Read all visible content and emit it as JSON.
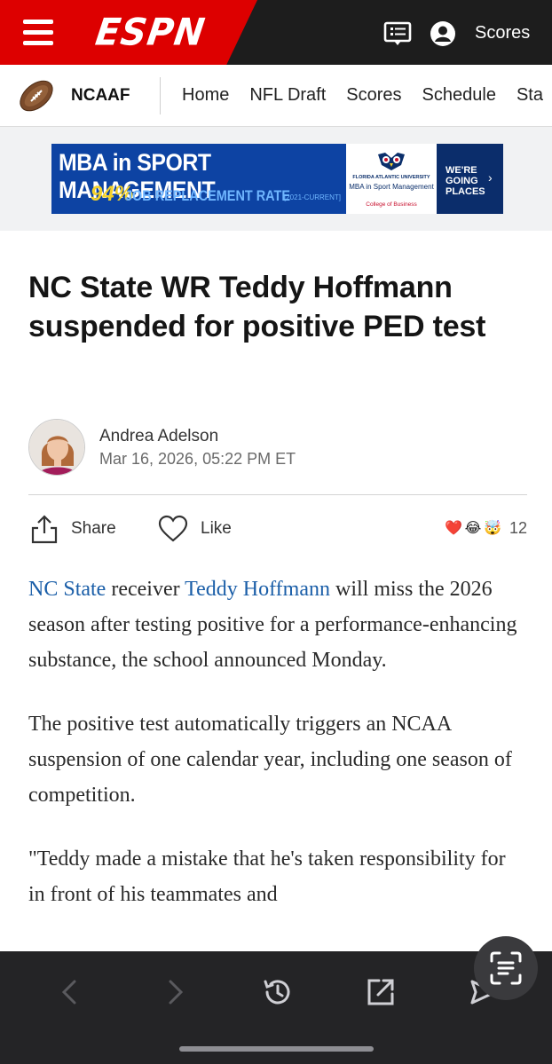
{
  "header": {
    "logo_text": "ESPN",
    "scores_label": "Scores"
  },
  "subnav": {
    "sport": "NCAAF",
    "items": [
      {
        "label": "Home"
      },
      {
        "label": "NFL Draft"
      },
      {
        "label": "Scores"
      },
      {
        "label": "Schedule"
      },
      {
        "label": "Sta"
      }
    ]
  },
  "ad": {
    "title": "MBA in SPORT MANAGEMENT",
    "percent": "94%",
    "rate_text": "JOB REPLACEMENT RATE",
    "years": "[2021-CURRENT]",
    "university": "FLORIDA ATLANTIC UNIVERSITY",
    "program": "MBA in Sport Management",
    "college": "College of Business",
    "cta": "WE'RE GOING PLACES",
    "cta_arrow": "›"
  },
  "article": {
    "headline": "NC State WR Teddy Hoffmann suspended for positive PED test",
    "author": "Andrea Adelson",
    "date": "Mar 16, 2026, 05:22 PM ET",
    "share_label": "Share",
    "like_label": "Like",
    "reactions": [
      "❤️",
      "😂",
      "🤯"
    ],
    "reaction_count": "12",
    "paragraphs": {
      "p1_link1": "NC State",
      "p1_mid": " receiver ",
      "p1_link2": "Teddy Hoffmann",
      "p1_rest": " will miss the 2026 season after testing positive for a performance-enhancing substance, the school announced Monday.",
      "p2": "The positive test automatically triggers an NCAA suspension of one calendar year, including one season of competition.",
      "p3": "\"Teddy made a mistake that he's taken responsibility for in front of his teammates and"
    }
  },
  "colors": {
    "espn_red": "#dd0000",
    "topbar": "#1d1d1d",
    "link": "#1a5ea8",
    "browser_bar": "#242426"
  },
  "browser": {
    "icons": [
      "back-arrow-icon",
      "forward-arrow-icon",
      "history-icon",
      "share-out-icon",
      "send-icon",
      "text-scan-icon"
    ]
  }
}
